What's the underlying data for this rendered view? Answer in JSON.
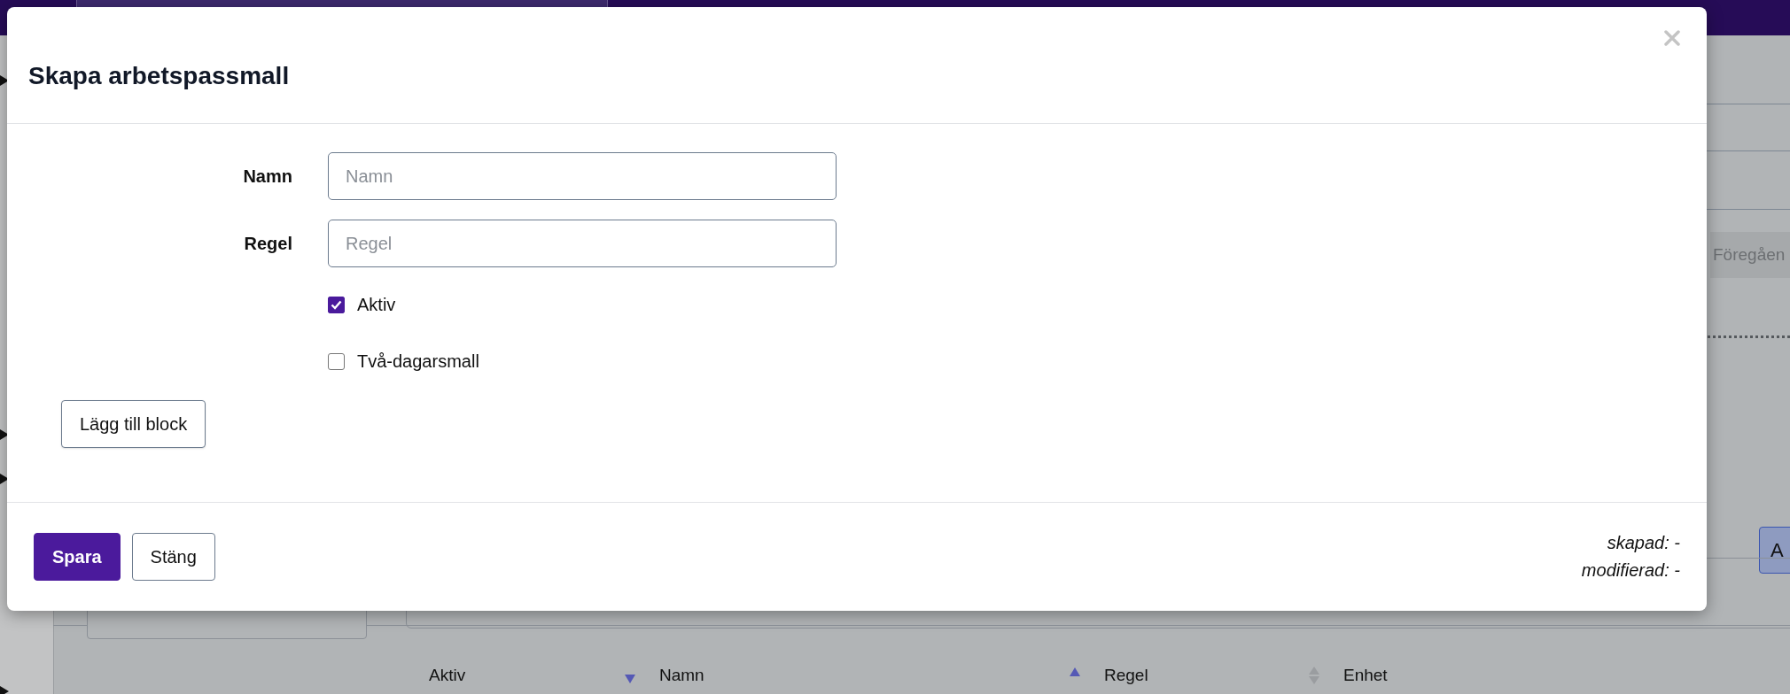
{
  "background": {
    "previous_button": "Föregåen",
    "side_button": "A",
    "table": {
      "columns": [
        {
          "label": "Aktiv",
          "sortable": true,
          "sorted": true,
          "ascending": false
        },
        {
          "label": "Namn",
          "sortable": true,
          "sorted": true,
          "ascending": true
        },
        {
          "label": "Regel",
          "sortable": true,
          "sorted": false
        },
        {
          "label": "Enhet",
          "sortable": false
        }
      ]
    }
  },
  "dialog": {
    "title": "Skapa arbetspassmall",
    "fields": [
      {
        "label": "Namn",
        "placeholder": "Namn"
      },
      {
        "label": "Regel",
        "placeholder": "Regel"
      }
    ],
    "checkboxes": [
      {
        "label": "Aktiv",
        "checked": true
      },
      {
        "label": "Två-dagarsmall",
        "checked": false
      }
    ],
    "add_block_button": "Lägg till block",
    "buttons": [
      {
        "label": "Spara",
        "kind": "primary"
      },
      {
        "label": "Stäng",
        "kind": "secondary"
      }
    ],
    "meta": [
      "skapad: -",
      "modifierad: -"
    ]
  }
}
